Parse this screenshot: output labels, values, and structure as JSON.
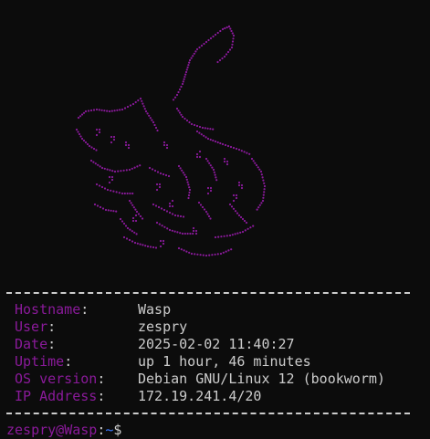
{
  "terminal": {
    "info": [
      {
        "key": "Hostname",
        "value": "Wasp"
      },
      {
        "key": "User",
        "value": "zespry"
      },
      {
        "key": "Date",
        "value": "2025-02-02 11:40:27"
      },
      {
        "key": "Uptime",
        "value": "up 1 hour, 46 minutes"
      },
      {
        "key": "OS version",
        "value": "Debian GNU/Linux 12 (bookworm)"
      },
      {
        "key": "IP Address",
        "value": "172.19.241.4/20"
      }
    ],
    "prompt": {
      "user_host": "zespry@Wasp",
      "separator": ":",
      "path": "~",
      "symbol": "$"
    }
  },
  "colors": {
    "background": "#0c0c0c",
    "key": "#8a1a9a",
    "text": "#cccccc",
    "path": "#3b78ff",
    "art": "#8a1a9a"
  },
  "art": {
    "icon": "braille-logo-art"
  }
}
